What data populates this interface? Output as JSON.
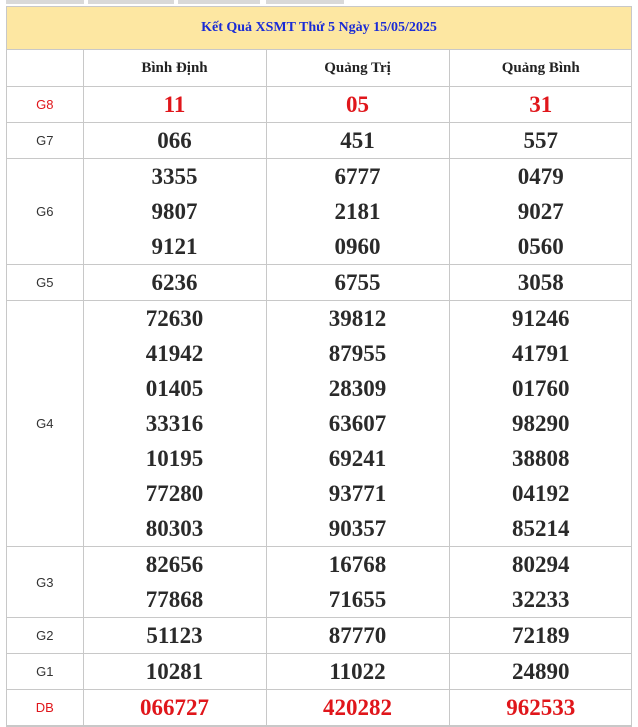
{
  "title": "Kết Quả XSMT Thứ 5 Ngày 15/05/2025",
  "provinces": [
    "Bình Định",
    "Quảng Trị",
    "Quảng Bình"
  ],
  "prizes": [
    {
      "label": "G8",
      "red": true,
      "rows": [
        [
          "11",
          "05",
          "31"
        ]
      ]
    },
    {
      "label": "G7",
      "red": false,
      "rows": [
        [
          "066",
          "451",
          "557"
        ]
      ]
    },
    {
      "label": "G6",
      "red": false,
      "rows": [
        [
          "3355",
          "6777",
          "0479"
        ],
        [
          "9807",
          "2181",
          "9027"
        ],
        [
          "9121",
          "0960",
          "0560"
        ]
      ]
    },
    {
      "label": "G5",
      "red": false,
      "rows": [
        [
          "6236",
          "6755",
          "3058"
        ]
      ]
    },
    {
      "label": "G4",
      "red": false,
      "rows": [
        [
          "72630",
          "39812",
          "91246"
        ],
        [
          "41942",
          "87955",
          "41791"
        ],
        [
          "01405",
          "28309",
          "01760"
        ],
        [
          "33316",
          "63607",
          "98290"
        ],
        [
          "10195",
          "69241",
          "38808"
        ],
        [
          "77280",
          "93771",
          "04192"
        ],
        [
          "80303",
          "90357",
          "85214"
        ]
      ]
    },
    {
      "label": "G3",
      "red": false,
      "rows": [
        [
          "82656",
          "16768",
          "80294"
        ],
        [
          "77868",
          "71655",
          "32233"
        ]
      ]
    },
    {
      "label": "G2",
      "red": false,
      "rows": [
        [
          "51123",
          "87770",
          "72189"
        ]
      ]
    },
    {
      "label": "G1",
      "red": false,
      "rows": [
        [
          "10281",
          "11022",
          "24890"
        ]
      ]
    },
    {
      "label": "DB",
      "red": true,
      "rows": [
        [
          "066727",
          "420282",
          "962533"
        ]
      ]
    }
  ]
}
